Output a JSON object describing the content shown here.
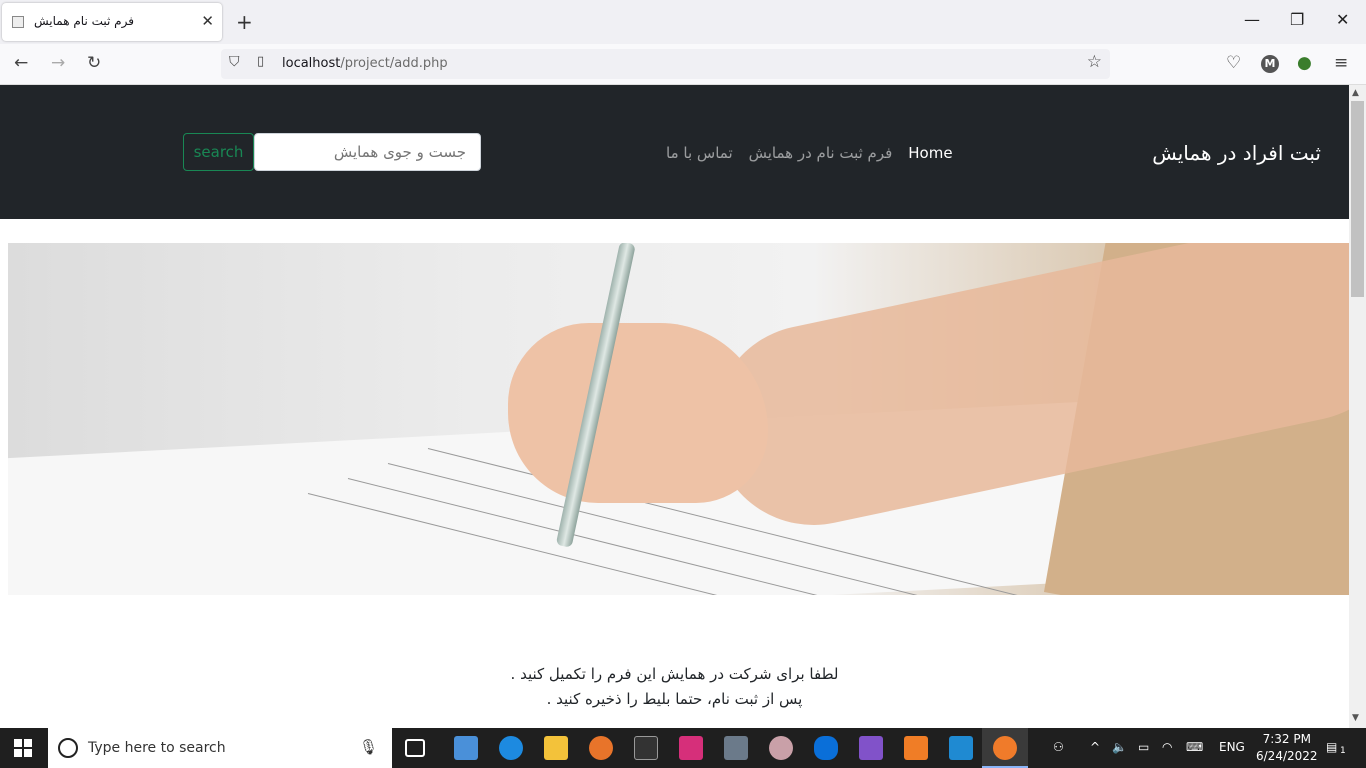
{
  "browser": {
    "tab_title": "فرم ثبت نام همایش",
    "tab_close": "✕",
    "new_tab": "+",
    "window_minimize": "—",
    "window_restore": "❐",
    "window_close": "✕",
    "url_host": "localhost",
    "url_path": "/project/add.php",
    "extension_letter": "M"
  },
  "site": {
    "brand": "ثبت افراد در همایش",
    "menu": [
      {
        "label": "Home"
      },
      {
        "label": "فرم ثبت نام در همایش"
      },
      {
        "label": "تماس با ما"
      }
    ],
    "search_placeholder": "جست و جوی همایش",
    "search_button": "search",
    "intro_line1": "لطفا برای شرکت در همایش این فرم را تکمیل کنید .",
    "intro_line2": "پس از ثبت نام، حتما بلیط را ذخیره کنید ."
  },
  "taskbar": {
    "search_placeholder": "Type here to search",
    "language": "ENG",
    "time": "7:32 PM",
    "date": "6/24/2022",
    "notification_count": "1"
  },
  "colors": {
    "navbar_bg": "#212529",
    "search_button": "#198754"
  }
}
